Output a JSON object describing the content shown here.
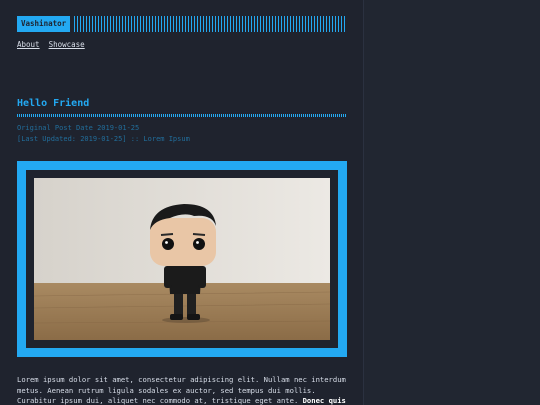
{
  "header": {
    "logo_text": "Vashinator",
    "logo_stripes_icon": "barcode-stripes"
  },
  "nav": {
    "items": [
      {
        "label": "About"
      },
      {
        "label": "Showcase"
      }
    ]
  },
  "post": {
    "title": "Hello Friend",
    "original_date": "Original Post Date 2019-01-25",
    "last_updated": "[Last Updated: 2019-01-25] :: Lorem Ipsum",
    "image_subject": "vinyl figure of a man in a black hoodie standing on a wooden table",
    "body_plain": "Lorem ipsum dolor sit amet, consectetur adipiscing elit. Nullam nec interdum metus. Aenean rutrum ligula sodales ex auctor, sed tempus dui mollis. Curabitur ipsum dui, aliquet nec commodo at, tristique eget ante. ",
    "body_bold": "Donec quis dolor nec"
  },
  "colors": {
    "background": "#1f232e",
    "accent": "#23a9f2",
    "text": "#d8dee9"
  }
}
